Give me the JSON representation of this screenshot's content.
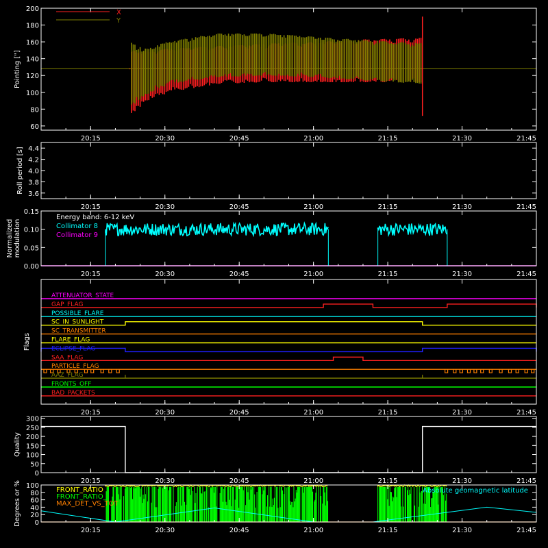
{
  "chart_data": [
    {
      "id": "pointing",
      "type": "line",
      "ylabel": "Pointing [\"]",
      "ylim": [
        55,
        200
      ],
      "yticks": [
        60,
        80,
        100,
        120,
        140,
        160,
        180,
        200
      ],
      "xlim": [
        "20:05",
        "21:45"
      ],
      "xticks": [
        "20:15",
        "20:30",
        "20:45",
        "21:00",
        "21:15",
        "21:30",
        "21:45"
      ],
      "legend_position": "top-left",
      "series": [
        {
          "name": "X",
          "color": "#ff2020",
          "x": [
            "20:05",
            "20:22",
            "20:22",
            "20:23",
            "20:25",
            "20:30",
            "20:40",
            "20:50",
            "21:00",
            "21:10",
            "21:22",
            "21:22",
            "21:45"
          ],
          "upper": [
            128,
            128,
            158,
            150,
            148,
            152,
            155,
            158,
            160,
            163,
            165,
            190,
            128
          ],
          "lower": [
            128,
            128,
            80,
            75,
            88,
            100,
            110,
            112,
            112,
            112,
            112,
            72,
            128
          ]
        },
        {
          "name": "Y",
          "color": "#808000",
          "x": [
            "20:05",
            "20:22",
            "20:22",
            "20:23",
            "20:25",
            "20:30",
            "20:40",
            "20:50",
            "21:00",
            "21:10",
            "21:22",
            "21:22",
            "21:45"
          ],
          "upper": [
            128,
            128,
            165,
            160,
            150,
            160,
            170,
            170,
            166,
            162,
            158,
            170,
            128
          ],
          "lower": [
            128,
            128,
            90,
            85,
            95,
            110,
            118,
            120,
            118,
            114,
            110,
            80,
            128
          ]
        }
      ]
    },
    {
      "id": "roll",
      "type": "line",
      "ylabel": "Roll period [s]",
      "ylim": [
        3.5,
        4.5
      ],
      "yticks": [
        "3.6",
        "3.8",
        "4.0",
        "4.2",
        "4.4"
      ],
      "xticks": [
        "20:15",
        "20:30",
        "20:45",
        "21:00",
        "21:15",
        "21:30",
        "21:45"
      ],
      "series": []
    },
    {
      "id": "modulation",
      "type": "line",
      "ylabel": [
        "Normalized",
        "modulation"
      ],
      "ylim": [
        0,
        0.15
      ],
      "yticks": [
        "0.00",
        "0.05",
        "0.10",
        "0.15"
      ],
      "xticks": [
        "20:15",
        "20:30",
        "20:45",
        "21:00",
        "21:15",
        "21:30",
        "21:45"
      ],
      "annotation": "Energy band: 6-12 keV",
      "series": [
        {
          "name": "Collimator 8",
          "color": "#00ffff",
          "segments": [
            [
              "20:18",
              "21:03",
              0.1
            ],
            [
              "21:13",
              "21:27",
              0.1
            ]
          ]
        },
        {
          "name": "Collimator 9",
          "color": "#ff00ff",
          "value": 0
        }
      ]
    },
    {
      "id": "flags",
      "type": "line",
      "ylabel": "Flags",
      "xticks": [
        "20:15",
        "20:30",
        "20:45",
        "21:00",
        "21:15",
        "21:30",
        "21:45"
      ],
      "series": [
        {
          "name": "ATTENUATOR_STATE",
          "color": "#ff00ff"
        },
        {
          "name": "GAP_FLAG",
          "color": "#ff2020",
          "high": [
            [
              "21:02",
              "21:12"
            ],
            [
              "21:27",
              "21:45"
            ]
          ]
        },
        {
          "name": "POSSIBLE_FLARE",
          "color": "#00ffff"
        },
        {
          "name": "SC_IN_SUNLIGHT",
          "color": "#ffff00",
          "high": [
            [
              "20:22",
              "21:22"
            ]
          ]
        },
        {
          "name": "SC_TRANSMITTER",
          "color": "#ff8000"
        },
        {
          "name": "FLARE_FLAG",
          "color": "#ffff00"
        },
        {
          "name": "ECLIPSE_FLAG",
          "color": "#2020ff",
          "high": [
            [
              "20:05",
              "20:22"
            ],
            [
              "21:22",
              "21:45"
            ]
          ]
        },
        {
          "name": "SAA_FLAG",
          "color": "#ff2020",
          "high": [
            [
              "21:04",
              "21:10"
            ]
          ]
        },
        {
          "name": "PARTICLE_FLAG",
          "color": "#ff8000"
        },
        {
          "name": "AAZ_FLAG",
          "color": "#808000"
        },
        {
          "name": "FRONTS_OFF",
          "color": "#00ff00"
        },
        {
          "name": "BAD_PACKETS",
          "color": "#ff2020"
        }
      ]
    },
    {
      "id": "quality",
      "type": "line",
      "ylabel": "Quality",
      "ylim": [
        0,
        310
      ],
      "yticks": [
        "0",
        "50",
        "100",
        "150",
        "200",
        "250",
        "300"
      ],
      "xticks": [
        "20:15",
        "20:30",
        "20:45",
        "21:00",
        "21:15",
        "21:30",
        "21:45"
      ],
      "series": [
        {
          "name": "",
          "color": "#ffffff",
          "x": [
            "20:05",
            "20:22",
            "20:22",
            "21:22",
            "21:22",
            "21:45"
          ],
          "values": [
            255,
            255,
            0,
            0,
            255,
            255
          ]
        }
      ]
    },
    {
      "id": "ratios",
      "type": "area",
      "ylabel": "Degrees or %",
      "ylim": [
        0,
        100
      ],
      "yticks": [
        "0",
        "20",
        "40",
        "60",
        "80",
        "100"
      ],
      "xticks": [
        "20:15",
        "20:30",
        "20:45",
        "21:00",
        "21:15",
        "21:30",
        "21:45"
      ],
      "annotation": "Absolute geomagnetic latitude",
      "series": [
        {
          "name": "FRONT_RATIO",
          "color": "#ffff00",
          "segments": [
            [
              "20:18",
              "21:03"
            ],
            [
              "21:13",
              "21:27"
            ]
          ],
          "value": 100
        },
        {
          "name": "FRONT_RATIO_",
          "color": "#00ff00",
          "segments": [
            [
              "20:18",
              "21:03"
            ],
            [
              "21:13",
              "21:27"
            ]
          ],
          "value": 95
        },
        {
          "name": "MAX_DET_VS_TOT",
          "color": "#ff8000",
          "value": 0
        },
        {
          "name": "Absolute geomagnetic latitude",
          "color": "#00ffff",
          "x": [
            "20:05",
            "20:20",
            "20:40",
            "21:00",
            "21:12",
            "21:35",
            "21:45"
          ],
          "values": [
            30,
            0,
            38,
            0,
            0,
            40,
            26
          ]
        }
      ]
    }
  ]
}
